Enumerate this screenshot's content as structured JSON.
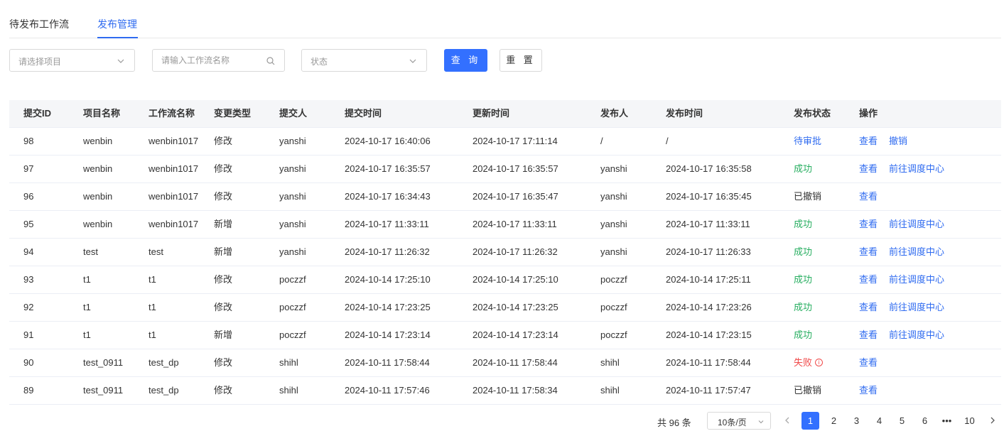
{
  "tabs": [
    {
      "label": "待发布工作流"
    },
    {
      "label": "发布管理"
    }
  ],
  "filters": {
    "project_placeholder": "请选择项目",
    "workflow_placeholder": "请输入工作流名称",
    "status_placeholder": "状态",
    "query_label": "查 询",
    "reset_label": "重 置"
  },
  "table": {
    "headers": [
      "提交ID",
      "项目名称",
      "工作流名称",
      "变更类型",
      "提交人",
      "提交时间",
      "更新时间",
      "发布人",
      "发布时间",
      "发布状态",
      "操作"
    ],
    "rows": [
      {
        "id": "98",
        "project": "wenbin",
        "workflow": "wenbin1017",
        "change": "修改",
        "submitter": "yanshi",
        "submit_time": "2024-10-17 16:40:06",
        "update_time": "2024-10-17 17:11:14",
        "publisher": "/",
        "publish_time": "/",
        "status": "待审批",
        "action1": "查看",
        "action2": "撤销"
      },
      {
        "id": "97",
        "project": "wenbin",
        "workflow": "wenbin1017",
        "change": "修改",
        "submitter": "yanshi",
        "submit_time": "2024-10-17 16:35:57",
        "update_time": "2024-10-17 16:35:57",
        "publisher": "yanshi",
        "publish_time": "2024-10-17 16:35:58",
        "status": "成功",
        "action1": "查看",
        "action2": "前往调度中心"
      },
      {
        "id": "96",
        "project": "wenbin",
        "workflow": "wenbin1017",
        "change": "修改",
        "submitter": "yanshi",
        "submit_time": "2024-10-17 16:34:43",
        "update_time": "2024-10-17 16:35:47",
        "publisher": "yanshi",
        "publish_time": "2024-10-17 16:35:45",
        "status": "已撤销",
        "action1": "查看",
        "action2": ""
      },
      {
        "id": "95",
        "project": "wenbin",
        "workflow": "wenbin1017",
        "change": "新增",
        "submitter": "yanshi",
        "submit_time": "2024-10-17 11:33:11",
        "update_time": "2024-10-17 11:33:11",
        "publisher": "yanshi",
        "publish_time": "2024-10-17 11:33:11",
        "status": "成功",
        "action1": "查看",
        "action2": "前往调度中心"
      },
      {
        "id": "94",
        "project": "test",
        "workflow": "test",
        "change": "新增",
        "submitter": "yanshi",
        "submit_time": "2024-10-17 11:26:32",
        "update_time": "2024-10-17 11:26:32",
        "publisher": "yanshi",
        "publish_time": "2024-10-17 11:26:33",
        "status": "成功",
        "action1": "查看",
        "action2": "前往调度中心"
      },
      {
        "id": "93",
        "project": "t1",
        "workflow": "t1",
        "change": "修改",
        "submitter": "poczzf",
        "submit_time": "2024-10-14 17:25:10",
        "update_time": "2024-10-14 17:25:10",
        "publisher": "poczzf",
        "publish_time": "2024-10-14 17:25:11",
        "status": "成功",
        "action1": "查看",
        "action2": "前往调度中心"
      },
      {
        "id": "92",
        "project": "t1",
        "workflow": "t1",
        "change": "修改",
        "submitter": "poczzf",
        "submit_time": "2024-10-14 17:23:25",
        "update_time": "2024-10-14 17:23:25",
        "publisher": "poczzf",
        "publish_time": "2024-10-14 17:23:26",
        "status": "成功",
        "action1": "查看",
        "action2": "前往调度中心"
      },
      {
        "id": "91",
        "project": "t1",
        "workflow": "t1",
        "change": "新增",
        "submitter": "poczzf",
        "submit_time": "2024-10-14 17:23:14",
        "update_time": "2024-10-14 17:23:14",
        "publisher": "poczzf",
        "publish_time": "2024-10-14 17:23:15",
        "status": "成功",
        "action1": "查看",
        "action2": "前往调度中心"
      },
      {
        "id": "90",
        "project": "test_0911",
        "workflow": "test_dp",
        "change": "修改",
        "submitter": "shihl",
        "submit_time": "2024-10-11 17:58:44",
        "update_time": "2024-10-11 17:58:44",
        "publisher": "shihl",
        "publish_time": "2024-10-11 17:58:44",
        "status": "失败",
        "action1": "查看",
        "action2": ""
      },
      {
        "id": "89",
        "project": "test_0911",
        "workflow": "test_dp",
        "change": "修改",
        "submitter": "shihl",
        "submit_time": "2024-10-11 17:57:46",
        "update_time": "2024-10-11 17:58:34",
        "publisher": "shihl",
        "publish_time": "2024-10-11 17:57:47",
        "status": "已撤销",
        "action1": "查看",
        "action2": ""
      }
    ]
  },
  "status_colors": {
    "待审批": "#2f6bf0",
    "成功": "#27ae60",
    "失败": "#f04a4a",
    "已撤销": "#333333"
  },
  "pagination": {
    "total_label": "共 96 条",
    "page_size": "10条/页",
    "pages": [
      "1",
      "2",
      "3",
      "4",
      "5",
      "6",
      "•••",
      "10"
    ],
    "current_page": "1"
  }
}
